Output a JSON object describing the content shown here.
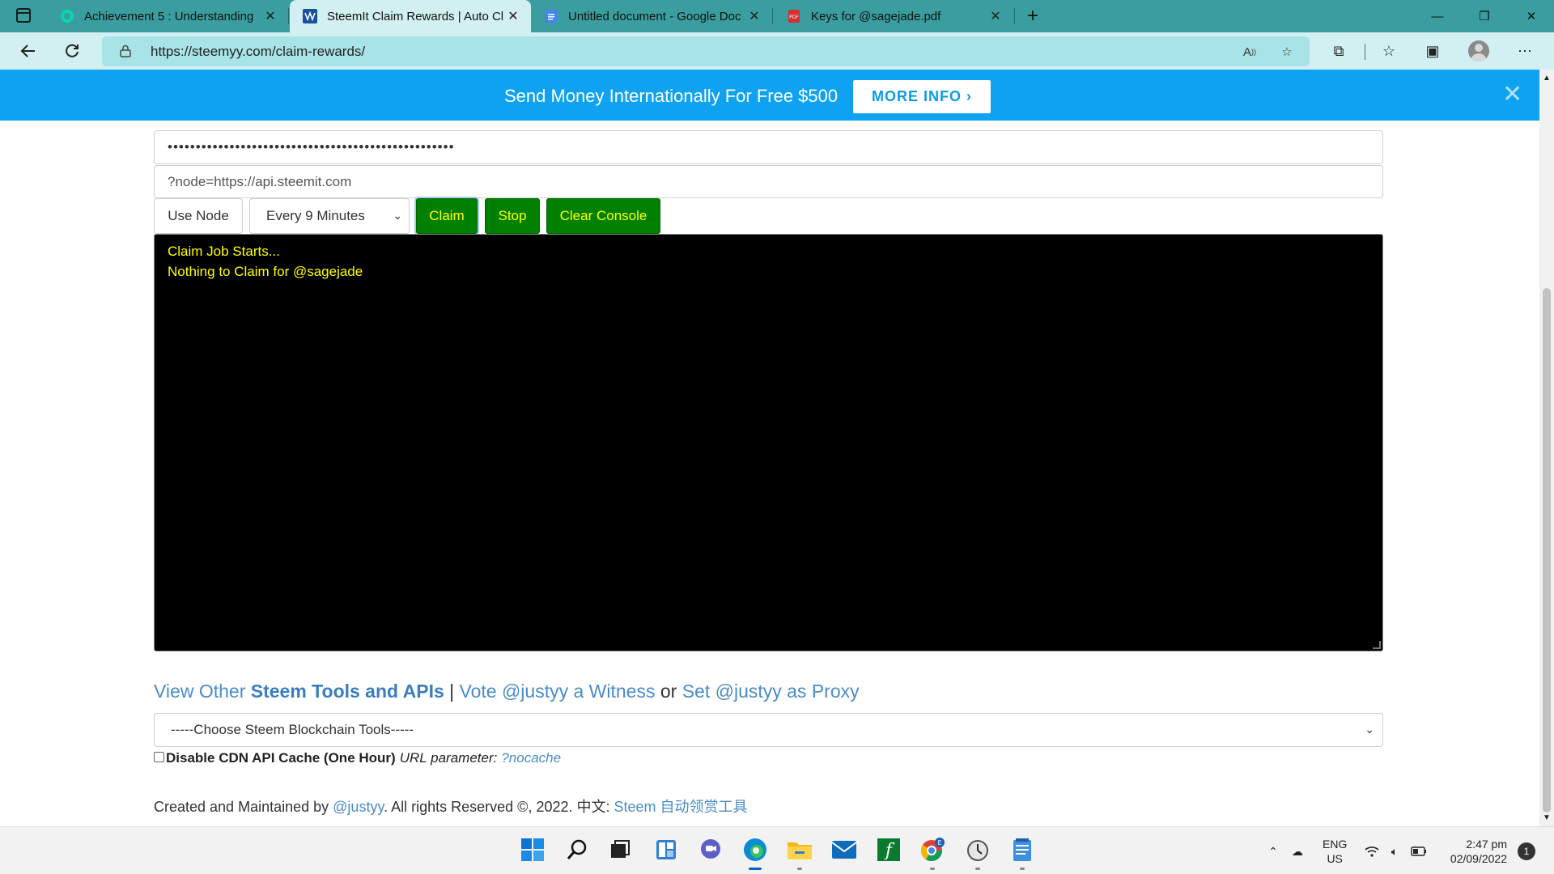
{
  "browser": {
    "tabs": [
      {
        "title": "Achievement 5 : Understanding ",
        "active": false
      },
      {
        "title": "SteemIt Claim Rewards | Auto Cl",
        "active": true
      },
      {
        "title": "Untitled document - Google Doc",
        "active": false
      },
      {
        "title": "Keys for @sagejade.pdf",
        "active": false
      }
    ],
    "url": "https://steemyy.com/claim-rewards/"
  },
  "ad": {
    "text": "Send Money Internationally For Free $500",
    "button": "MORE INFO ›",
    "close": "✕"
  },
  "form": {
    "password_mask": "•••••••••••••••••••••••••••••••••••••••••••••••••••",
    "node_placeholder": "?node=https://api.steemit.com",
    "use_node_label": "Use Node",
    "interval_selected": "Every 9 Minutes",
    "claim_label": "Claim",
    "stop_label": "Stop",
    "clear_console_label": "Clear Console"
  },
  "console": {
    "lines": [
      "Claim Job Starts...",
      "Nothing to Claim for @sagejade"
    ]
  },
  "links": {
    "view_other": "View Other ",
    "steem_tools": "Steem Tools and APIs",
    "separator": " | ",
    "vote": "Vote @justyy a Witness",
    "or": " or ",
    "proxy": "Set @justyy as Proxy"
  },
  "tools_select": {
    "selected": "-----Choose Steem Blockchain Tools-----"
  },
  "cdn": {
    "label": "Disable CDN API Cache (One Hour)",
    "url_param_label": "URL parameter:",
    "url_param_value": "?nocache"
  },
  "footer": {
    "prefix": "Created and Maintained by ",
    "author": "@justyy",
    "middle": ". All rights Reserved ©, 2022. 中文: ",
    "cn_link": "Steem 自动领赏工具"
  },
  "taskbar": {
    "lang_line1": "ENG",
    "lang_line2": "US",
    "time": "2:47 pm",
    "date": "02/09/2022",
    "notification_count": "1"
  },
  "colors": {
    "tabstrip": "#3a9d9f",
    "toolbar": "#d2eff1",
    "ad_banner": "#0ea2f0",
    "button_green": "#008000",
    "button_text_yellow": "#ffff00",
    "link_blue": "#4a8cc9"
  }
}
